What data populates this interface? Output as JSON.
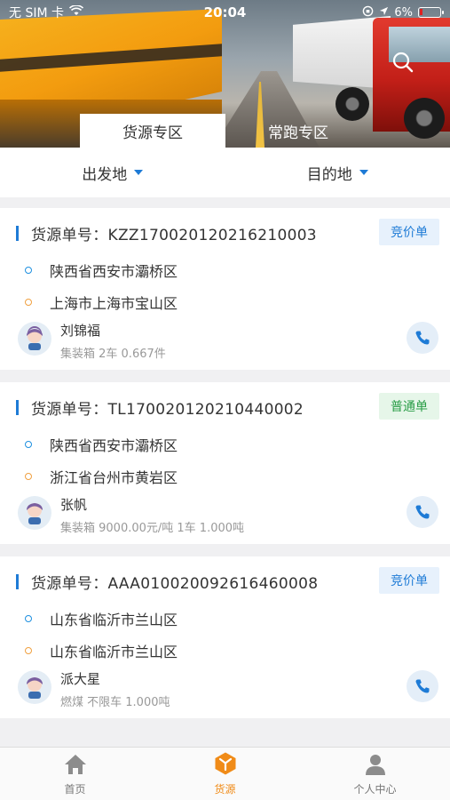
{
  "status_bar": {
    "carrier": "无 SIM 卡",
    "time": "20:04",
    "battery": "6%"
  },
  "tabs": [
    {
      "label": "货源专区",
      "active": true
    },
    {
      "label": "常跑专区",
      "active": false
    }
  ],
  "filters": {
    "origin": "出发地",
    "destination": "目的地"
  },
  "cards": [
    {
      "number": "货源单号：KZZ170020120216210003",
      "badge": "竞价单",
      "badge_color": "#1e7bd6",
      "from": "陕西省西安市灞桥区",
      "to": "上海市上海市宝山区",
      "person": "刘锦福",
      "meta": "集装箱 2车 0.667件"
    },
    {
      "number": "货源单号：TL170020120210440002",
      "badge": "普通单",
      "badge_color": "#2a9d47",
      "from": "陕西省西安市灞桥区",
      "to": "浙江省台州市黄岩区",
      "person": "张帆",
      "meta": "集装箱 9000.00元/吨 1车 1.000吨"
    },
    {
      "number": "货源单号：AAA010020092616460008",
      "badge": "竞价单",
      "badge_color": "#1e7bd6",
      "from": "山东省临沂市兰山区",
      "to": "山东省临沂市兰山区",
      "person": "派大星",
      "meta": "燃煤 不限车 1.000吨"
    }
  ],
  "tabbar": [
    {
      "label": "首页",
      "icon": "home-icon",
      "active": false
    },
    {
      "label": "货源",
      "icon": "cargo-box-icon",
      "active": true
    },
    {
      "label": "个人中心",
      "icon": "user-icon",
      "active": false
    }
  ],
  "colors": {
    "accent": "#1e7bd6",
    "active_tab": "#f08b18"
  }
}
